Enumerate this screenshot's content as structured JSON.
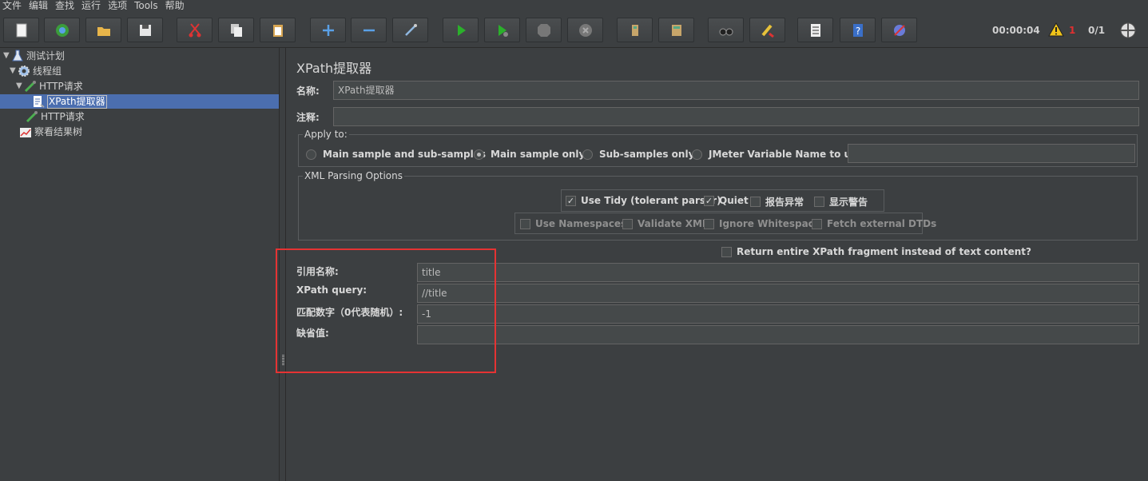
{
  "menu": [
    "文件",
    "编辑",
    "查找",
    "运行",
    "选项",
    "Tools",
    "帮助"
  ],
  "toolbar": {
    "buttons": [
      "new-icon",
      "templates-icon",
      "open-icon",
      "save-icon",
      "cut-icon",
      "copy-icon",
      "paste-icon",
      "expand-icon",
      "collapse-icon",
      "toggle-icon",
      "start-icon",
      "start-no-pause-icon",
      "stop-icon",
      "shutdown-icon",
      "clear-icon",
      "clear-all-icon",
      "search-icon",
      "reset-search-icon",
      "function-helper-icon",
      "help-icon",
      "remote-icon"
    ],
    "timer": "00:00:04",
    "warn_count": "1",
    "threads": "0/1"
  },
  "tree": {
    "test_plan": "测试计划",
    "thread_group": "线程组",
    "http_request_1": "HTTP请求",
    "xpath_extractor": "XPath提取器",
    "http_request_2": "HTTP请求",
    "results_tree": "察看结果树"
  },
  "panel": {
    "title": "XPath提取器",
    "name_label": "名称:",
    "name_value": "XPath提取器",
    "comment_label": "注释:",
    "comment_value": "",
    "apply_to": {
      "title": "Apply to:",
      "options": [
        "Main sample and sub-samples",
        "Main sample only",
        "Sub-samples only",
        "JMeter Variable Name to use"
      ],
      "selected": "Main sample only",
      "var_value": ""
    },
    "xml_options": {
      "title": "XML Parsing Options",
      "use_tidy": "Use Tidy (tolerant parser)",
      "quiet": "Quiet",
      "report_errors": "报告异常",
      "show_warnings": "显示警告",
      "use_namespaces": "Use Namespaces",
      "validate_xml": "Validate XML",
      "ignore_whitespace": "Ignore Whitespace",
      "fetch_dtds": "Fetch external DTDs"
    },
    "return_fragment": "Return entire XPath fragment instead of text content?",
    "ref_name_label": "引用名称:",
    "ref_name_value": "title",
    "xpath_query_label": "XPath query:",
    "xpath_query_value": "//title",
    "match_no_label": "匹配数字（0代表随机）:",
    "match_no_value": "-1",
    "default_label": "缺省值:",
    "default_value": ""
  },
  "colors": {
    "selection": "#4b6eaf",
    "highlight_box": "#e53333",
    "background": "#3c3f41"
  }
}
